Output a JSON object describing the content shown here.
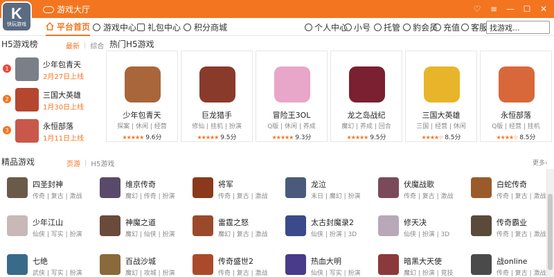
{
  "window": {
    "title": "游戏大厅",
    "logo_text": "K",
    "logo_sub": "快玩游戏"
  },
  "nav": {
    "tabs": [
      {
        "label": "平台首页",
        "icon": "home-icon"
      },
      {
        "label": "游戏中心",
        "icon": "gamepad-icon"
      },
      {
        "label": "礼包中心",
        "icon": "gift-icon"
      },
      {
        "label": "积分商城",
        "icon": "coins-icon"
      }
    ],
    "right": [
      {
        "label": "个人中心",
        "icon": "user-icon"
      },
      {
        "label": "小号",
        "icon": "user-alt-icon"
      },
      {
        "label": "托管",
        "icon": "hosting-icon"
      },
      {
        "label": "豹会员",
        "icon": "vip-icon"
      },
      {
        "label": "充值",
        "icon": "recharge-icon"
      },
      {
        "label": "客服",
        "icon": "headset-icon"
      }
    ],
    "search_value": "找游戏..."
  },
  "h5_rank": {
    "title": "H5游戏榜",
    "tab_latest": "最新",
    "tab_all": "综合",
    "items": [
      {
        "num": "1",
        "name": "少年包青天",
        "date": "2月27日上线",
        "color": "#7a7f88"
      },
      {
        "num": "2",
        "name": "三国大英雄",
        "date": "1月30日上线",
        "color": "#b5472e"
      },
      {
        "num": "3",
        "name": "永恒部落",
        "date": "1月11日上线",
        "color": "#c9584a"
      }
    ]
  },
  "hot_h5": {
    "title": "热门H5游戏",
    "cards": [
      {
        "name": "少年包青天",
        "tags": "探案 | 休闲 | 经营",
        "stars": "★★★★★",
        "rating": "9.6分",
        "color": "#a8663a"
      },
      {
        "name": "巨龙猎手",
        "tags": "修仙 | 挂机 | 扮演",
        "stars": "★★★★★",
        "rating": "9.5分",
        "color": "#8a3a2a"
      },
      {
        "name": "冒险王3OL",
        "tags": "Q版 | 休闲 | 养成",
        "stars": "★★★★★",
        "rating": "9.3分",
        "color": "#e8a6c8"
      },
      {
        "name": "龙之岛战纪",
        "tags": "魔幻 | 养成 | 回合",
        "stars": "★★★★★",
        "rating": "9.5分",
        "color": "#7a2030"
      },
      {
        "name": "三国大英雄",
        "tags": "三国 | 经营 | 休闲",
        "stars": "★★★★☆",
        "rating": "8.5分",
        "color": "#e8b42a"
      },
      {
        "name": "永恒部落",
        "tags": "Q版 | 经营 | 挂机",
        "stars": "★★★★☆",
        "rating": "8.5分",
        "color": "#d8683a"
      }
    ]
  },
  "featured": {
    "title": "精品游戏",
    "tab_pc": "页游",
    "tab_h5": "H5游戏",
    "more": "更多",
    "games": [
      {
        "name": "四圣封神",
        "tags": "传奇 | 复古 | 激战",
        "color": "#6a5a4a"
      },
      {
        "name": "维京传奇",
        "tags": "魔幻 | 传奇 | 扮演",
        "color": "#5a4a6a"
      },
      {
        "name": "将军",
        "tags": "传奇 | 复古 | 激战",
        "color": "#8a3a1a"
      },
      {
        "name": "龙泣",
        "tags": "末日 | 魔幻 | 扮演",
        "color": "#4a5a7a"
      },
      {
        "name": "伏魔战歌",
        "tags": "传奇 | 复古 | 激战",
        "color": "#7a4a5a"
      },
      {
        "name": "白蛇传奇",
        "tags": "传奇 | 复古 | 激战",
        "color": "#9a5a2a"
      },
      {
        "name": "少年江山",
        "tags": "仙侠 | 写实 | 扮演",
        "color": "#c8b8b8"
      },
      {
        "name": "神魔之道",
        "tags": "魔幻 | 仙侠 | 扮演",
        "color": "#6a4a3a"
      },
      {
        "name": "雷霆之怒",
        "tags": "魔幻 | 复古 | 激战",
        "color": "#9a4a2a"
      },
      {
        "name": "太古封魔录2",
        "tags": "仙侠 | 扮演 | 3D",
        "color": "#3a4a8a"
      },
      {
        "name": "修天决",
        "tags": "仙侠 | 扮演 | 3D",
        "color": "#b8a8b8"
      },
      {
        "name": "传奇霸业",
        "tags": "传奇 | 复古 | 激战",
        "color": "#5a4a3a"
      },
      {
        "name": "七绝",
        "tags": "武侠 | 写实 | 扮演",
        "color": "#3a6a8a"
      },
      {
        "name": "百战沙城",
        "tags": "魔幻 | 攻城 | 扮演",
        "color": "#8a6a3a"
      },
      {
        "name": "传奇盛世2",
        "tags": "传奇 | 复古 | 激战",
        "color": "#aa4a2a"
      },
      {
        "name": "热血大明",
        "tags": "仙侠 | 写实 | 扮演",
        "color": "#4a3a8a"
      },
      {
        "name": "暗黑大天使",
        "tags": "魔幻 | 扮演 | 竞技",
        "color": "#8a3a3a"
      },
      {
        "name": "战online",
        "tags": "传奇 | 复古 | 激战",
        "color": "#4a4a4a"
      }
    ]
  },
  "colors": {
    "accent": "#f3751f"
  }
}
